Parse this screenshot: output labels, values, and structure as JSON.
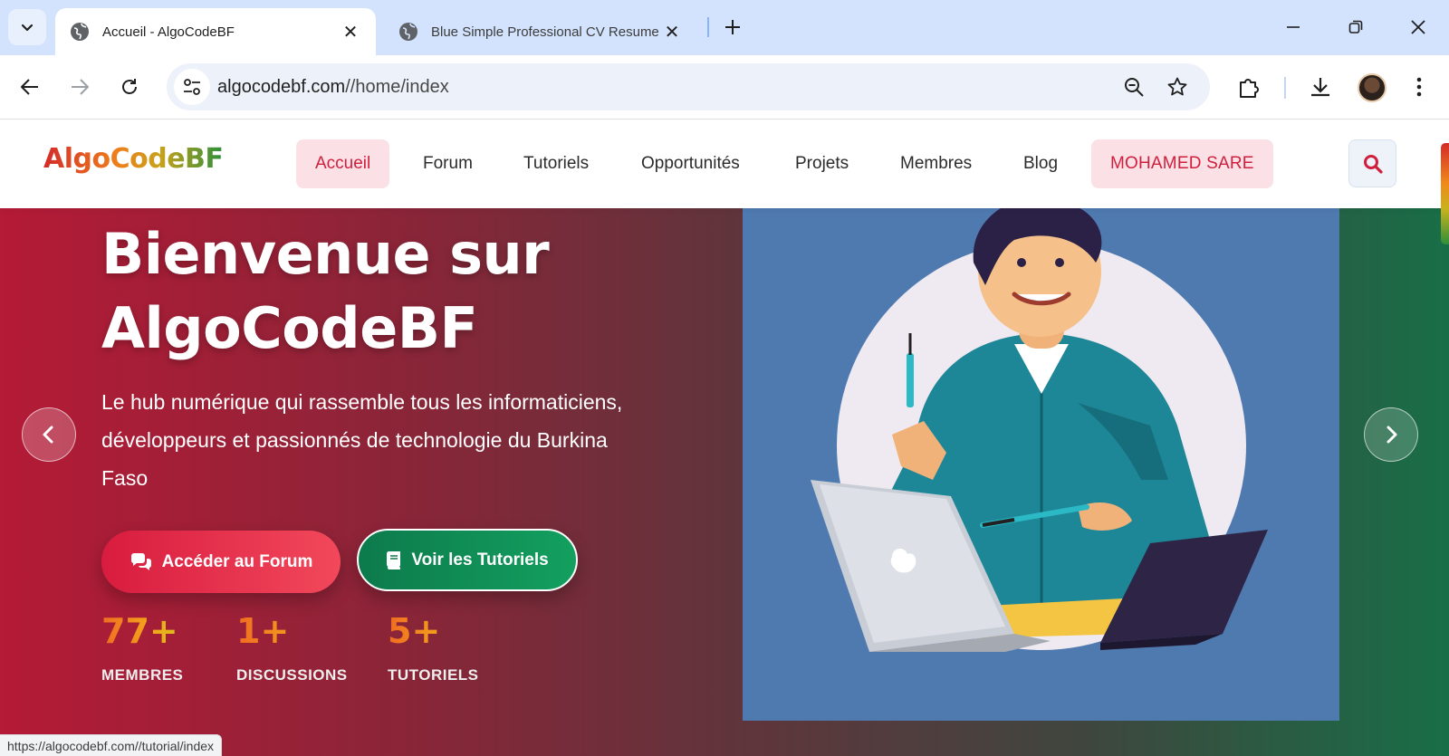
{
  "browser": {
    "tabs": [
      {
        "title": "Accueil - AlgoCodeBF",
        "active": true
      },
      {
        "title": "Blue Simple Professional CV Resume",
        "active": false
      }
    ],
    "url_host": "algocodebf.com",
    "url_path": "//home/index",
    "status_url": "https://algocodebf.com//tutorial/index"
  },
  "site": {
    "logo": "AlgoCodeBF",
    "menu": [
      {
        "label": "Accueil",
        "active": true
      },
      {
        "label": "Forum"
      },
      {
        "label": "Tutoriels"
      },
      {
        "label": "Opportunités"
      },
      {
        "label": "Projets"
      },
      {
        "label": "Membres"
      },
      {
        "label": "Blog"
      }
    ],
    "user_label": "MOHAMED SARE"
  },
  "hero": {
    "title": "Bienvenue sur AlgoCodeBF",
    "subtitle": "Le hub numérique qui rassemble tous les informaticiens, développeurs et passionnés de technologie du Burkina Faso",
    "buttons": {
      "forum": "Accéder au Forum",
      "tutorials": "Voir les Tutoriels"
    },
    "stats": [
      {
        "value": "77+",
        "label": "MEMBRES"
      },
      {
        "value": "1+",
        "label": "DISCUSSIONS"
      },
      {
        "value": "5+",
        "label": "TUTORIELS"
      }
    ]
  },
  "colors": {
    "brand_red": "#cf1f3d",
    "brand_green": "#13a05f",
    "tabstrip": "#d3e3fd"
  },
  "icons": [
    "globe-icon",
    "close-icon",
    "plus-icon",
    "minimize-icon",
    "restore-icon",
    "back-icon",
    "forward-icon",
    "reload-icon",
    "site-info-icon",
    "zoom-icon",
    "star-icon",
    "extensions-icon",
    "download-icon",
    "more-icon",
    "search-icon",
    "comments-icon",
    "book-icon",
    "chevron-left-icon",
    "chevron-right-icon"
  ]
}
